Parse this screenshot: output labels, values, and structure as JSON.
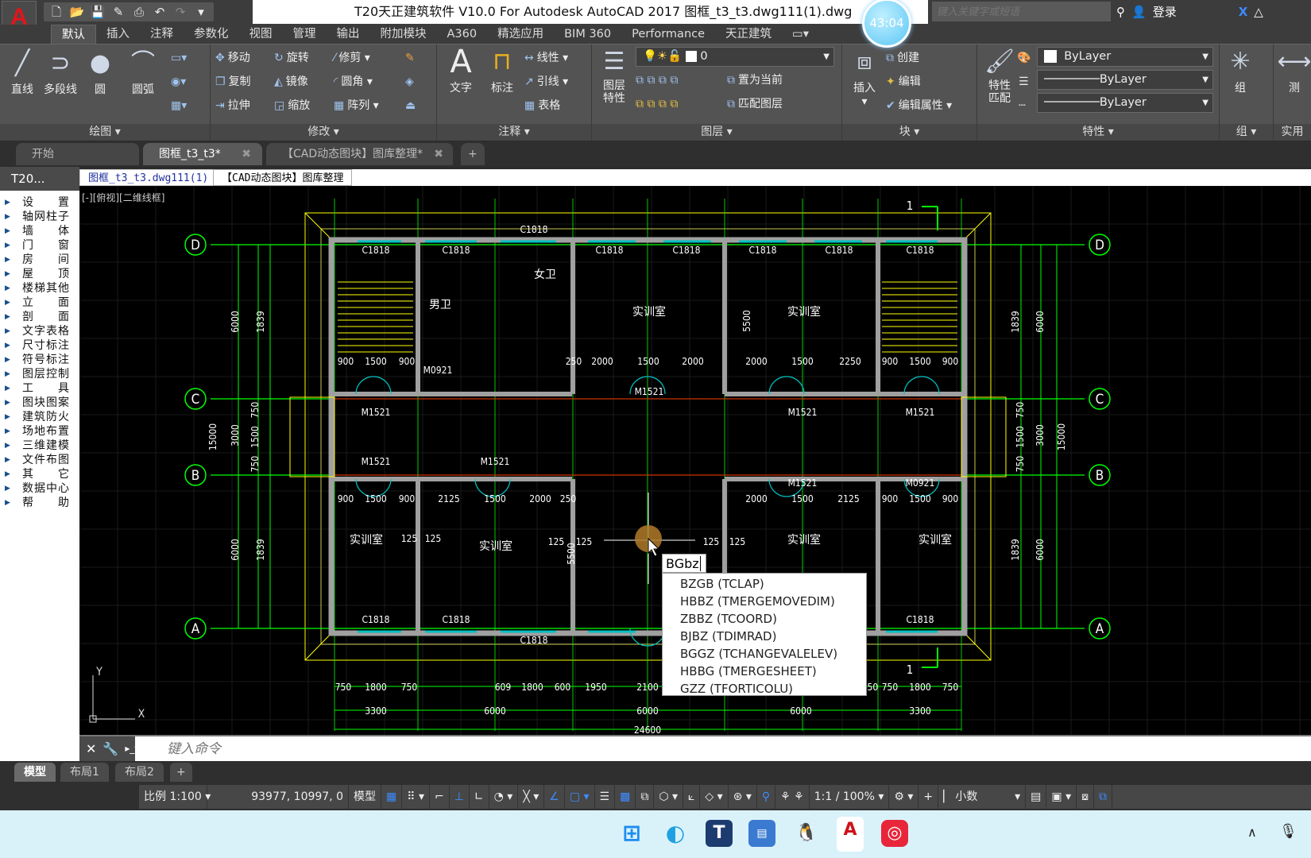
{
  "title_bar": {
    "app_icon": "autocad-logo",
    "title": "T20天正建筑软件 V10.0 For Autodesk AutoCAD 2017    图框_t3_t3.dwg111(1).dwg",
    "search_placeholder": "键入关键字或短语",
    "login": "登录",
    "timer": "43:04",
    "quick_access": [
      "new-icon",
      "open-icon",
      "save-icon",
      "saveas-icon",
      "print-icon",
      "undo-icon",
      "redo-icon",
      "customize-icon"
    ]
  },
  "ribbon_tabs": [
    "默认",
    "插入",
    "注释",
    "参数化",
    "视图",
    "管理",
    "输出",
    "附加模块",
    "A360",
    "精选应用",
    "BIM 360",
    "Performance",
    "天正建筑"
  ],
  "ribbon": {
    "draw": {
      "label": "绘图",
      "line": "直线",
      "polyline": "多段线",
      "circle": "圆",
      "arc": "圆弧"
    },
    "modify": {
      "label": "修改",
      "items": [
        "移动",
        "旋转",
        "修剪",
        "复制",
        "镜像",
        "圆角",
        "拉伸",
        "缩放",
        "阵列"
      ]
    },
    "annotation": {
      "label": "注释",
      "text": "文字",
      "dim": "标注",
      "items": [
        "线性",
        "引线",
        "表格"
      ]
    },
    "layers": {
      "label": "图层",
      "props": "图层\n特性",
      "layer_value": "0",
      "set_current": "置为当前",
      "match": "匹配图层"
    },
    "block": {
      "label": "块",
      "insert": "插入",
      "items": [
        "创建",
        "编辑",
        "编辑属性"
      ]
    },
    "properties": {
      "label": "特性",
      "match": "特性\n匹配",
      "color": "ByLayer",
      "linetype": "ByLayer",
      "lineweight": "ByLayer"
    },
    "group": {
      "label": "组",
      "group": "组"
    },
    "utilities": {
      "label": "实用",
      "measure": "测"
    }
  },
  "doc_tabs": [
    "开始",
    "图框_t3_t3*",
    "【CAD动态图块】图库整理*"
  ],
  "sidebar": {
    "header": "T20...",
    "items": [
      "设置",
      "轴网柱子",
      "墙体",
      "门窗",
      "房间",
      "屋顶",
      "楼梯其他",
      "立面",
      "剖面",
      "文字表格",
      "尺寸标注",
      "符号标注",
      "图层控制",
      "工具",
      "图块图案",
      "建筑防火",
      "场地布置",
      "三维建模",
      "文件布图",
      "其它",
      "数据中心",
      "帮助"
    ]
  },
  "drawing_tabs": [
    "图框_t3_t3.dwg111(1)",
    "【CAD动态图块】图库整理"
  ],
  "viewport_label": "[-][俯视][二维线框]",
  "drawing": {
    "axes_rows": [
      "D",
      "C",
      "B",
      "A"
    ],
    "rooms": [
      "实训室",
      "实训室",
      "实训室",
      "实训室",
      "实训室",
      "实训室",
      "男卫",
      "女卫"
    ],
    "windows": [
      "C1818",
      "C1818",
      "C1818",
      "C1818",
      "C1818",
      "C1818",
      "C1818",
      "C1818",
      "C1818",
      "C1818",
      "C1818",
      "C1818"
    ],
    "doors": [
      "M1521",
      "M1521",
      "M1521",
      "M1521",
      "M1521",
      "M1521",
      "M1521",
      "M0921",
      "M0921"
    ],
    "left_dims": [
      "15000",
      "6000",
      "3000",
      "6000",
      "1839",
      "1839",
      "750",
      "1500",
      "750"
    ],
    "right_dims": [
      "15000",
      "6000",
      "3000",
      "6000",
      "1839",
      "1839",
      "750",
      "1500",
      "750"
    ],
    "bottom_dims_1": [
      "750",
      "1800",
      "750",
      "609",
      "1800",
      "600",
      "1950",
      "2100",
      "750",
      "750",
      "1800",
      "750"
    ],
    "bottom_dims_2": [
      "3300",
      "6000",
      "6000",
      "6000",
      "3300"
    ],
    "bottom_total": "24600",
    "top_row_dims": [
      "900",
      "1500",
      "900",
      "2000",
      "1500",
      "2000",
      "250",
      "2000",
      "1500",
      "2250",
      "900",
      "1500",
      "900"
    ],
    "mid_row_dims": [
      "900",
      "1500",
      "900",
      "2125",
      "1500",
      "2000",
      "250",
      "2000",
      "1500",
      "2125",
      "900",
      "1500",
      "900"
    ],
    "misc": [
      "125",
      "125",
      "125",
      "125",
      "125",
      "125",
      "5500",
      "5500",
      "1",
      "1",
      "Y",
      "X"
    ]
  },
  "command": {
    "input": "BGbz",
    "suggestions": [
      "BZGB (TCLAP)",
      "HBBZ (TMERGEMOVEDIM)",
      "ZBBZ (TCOORD)",
      "BJBZ (TDIMRAD)",
      "BGGZ (TCHANGEVALELEV)",
      "HBBG (TMERGESHEET)",
      "GZZ (TFORTICOLU)"
    ],
    "placeholder": "键入命令"
  },
  "layout_tabs": [
    "模型",
    "布局1",
    "布局2",
    "+"
  ],
  "status_bar": {
    "scale": "比例 1:100",
    "coords": "93977, 10997, 0",
    "model": "模型",
    "annotation_scale": "1:1 / 100%",
    "units": "小数"
  },
  "taskbar": [
    "windows-start-icon",
    "edge-icon",
    "tangent-icon",
    "tarch-icon",
    "qq-icon",
    "autocad-icon",
    "netease-music-icon"
  ],
  "colors": {
    "grid_green": "#00ff00",
    "wall_gray": "#a0a0a0",
    "outline_yellow": "#ffff00",
    "door_cyan": "#00c0c0",
    "axis_red": "#ff0000",
    "accent_blue": "#3d8bff"
  }
}
